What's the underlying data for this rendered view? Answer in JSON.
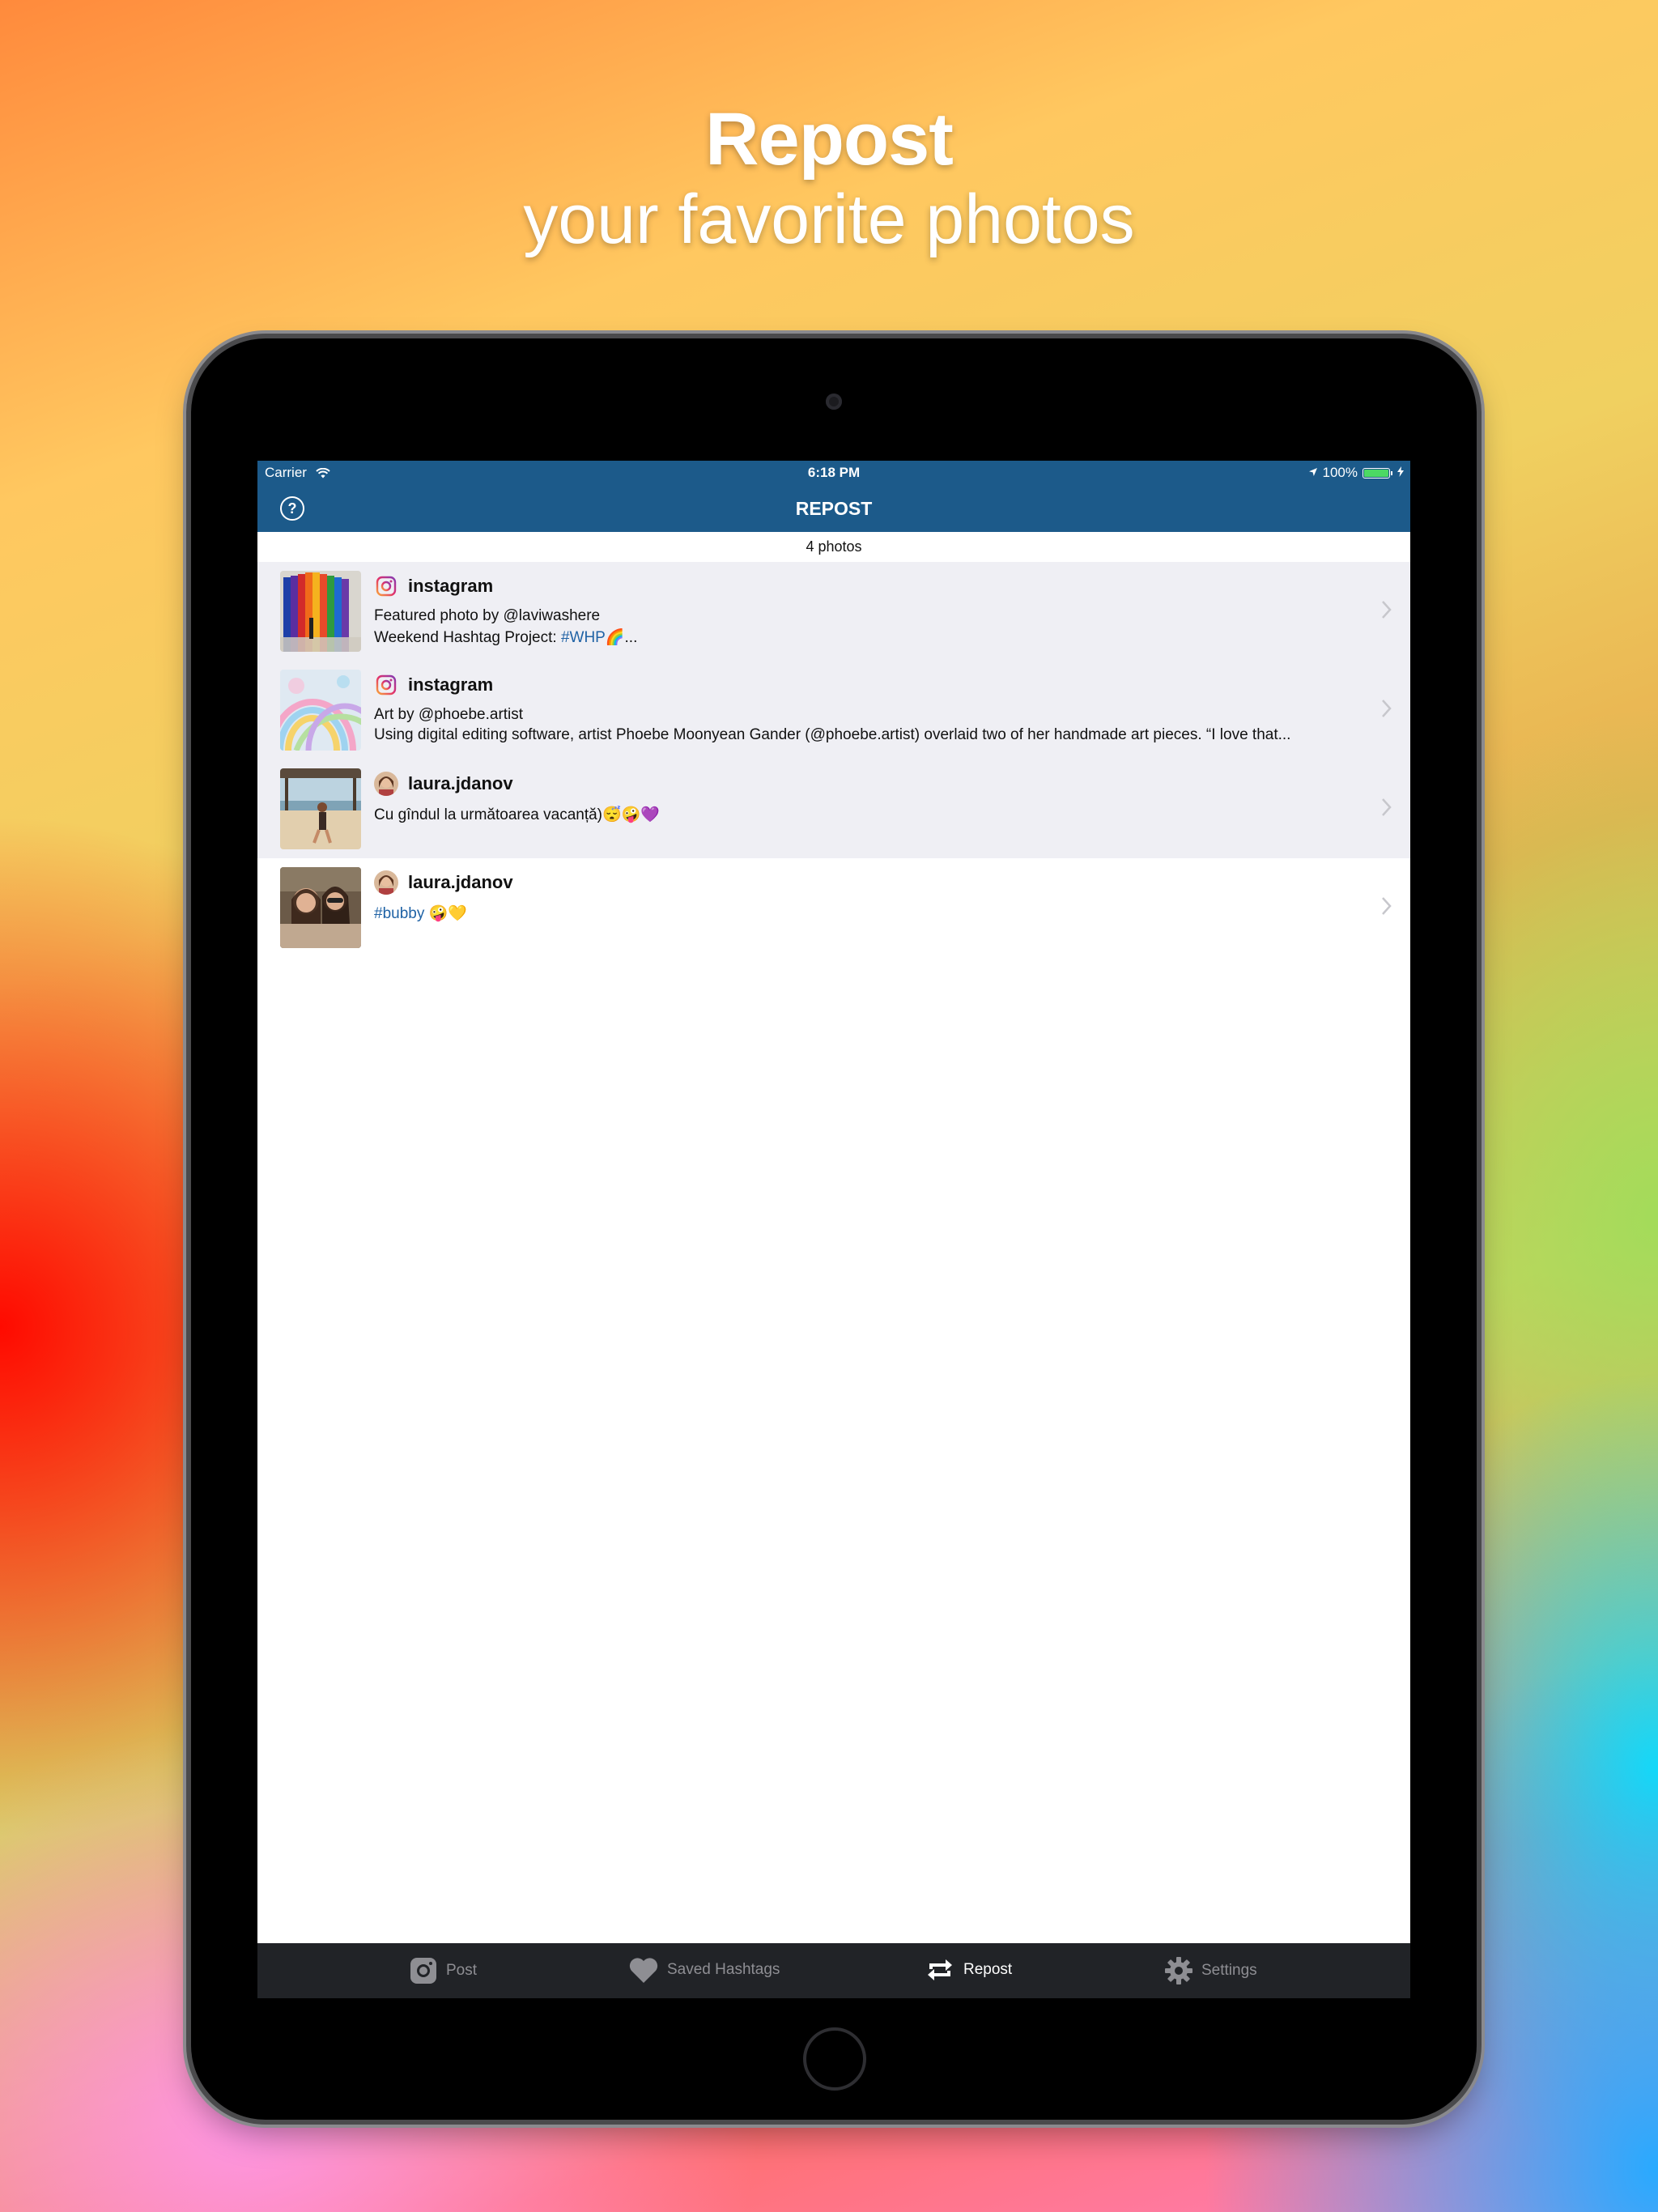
{
  "promo": {
    "title": "Repost",
    "subtitle": "your favorite photos"
  },
  "status_bar": {
    "carrier": "Carrier",
    "time": "6:18 PM",
    "battery": "100%",
    "battery_level": 1.0
  },
  "nav": {
    "title": "REPOST",
    "help_icon": "question-circle-icon"
  },
  "list_header": "4 photos",
  "posts": [
    {
      "username": "instagram",
      "line1": "Featured photo by @laviwashere",
      "line2_text": "Weekend Hashtag Project: ",
      "line2_tag": "#WHP",
      "line2_tail": "🌈...",
      "highlighted": true
    },
    {
      "username": "instagram",
      "line1": "Art by @phoebe.artist",
      "line2_text": "Using digital editing software, artist Phoebe Moonyean Gander (@phoebe.artist) overlaid two of her handmade art pieces. “I love that...",
      "highlighted": true
    },
    {
      "username": "laura.jdanov",
      "line1": "Cu gîndul la următoarea vacanță)😴🤪💜",
      "highlighted": true
    },
    {
      "username": "laura.jdanov",
      "line1_tag": "#bubby",
      "line1_tail": " 🤪💛",
      "highlighted": false
    }
  ],
  "tabs": [
    {
      "label": "Post",
      "icon": "camera-icon",
      "active": false
    },
    {
      "label": "Saved Hashtags",
      "icon": "heart-icon",
      "active": false
    },
    {
      "label": "Repost",
      "icon": "repost-icon",
      "active": true
    },
    {
      "label": "Settings",
      "icon": "gear-icon",
      "active": false
    }
  ],
  "colors": {
    "nav_bar": "#1c5a8a",
    "hashtag": "#1f62a5",
    "tab_bar": "#212327",
    "row_highlight": "#efeff4"
  }
}
